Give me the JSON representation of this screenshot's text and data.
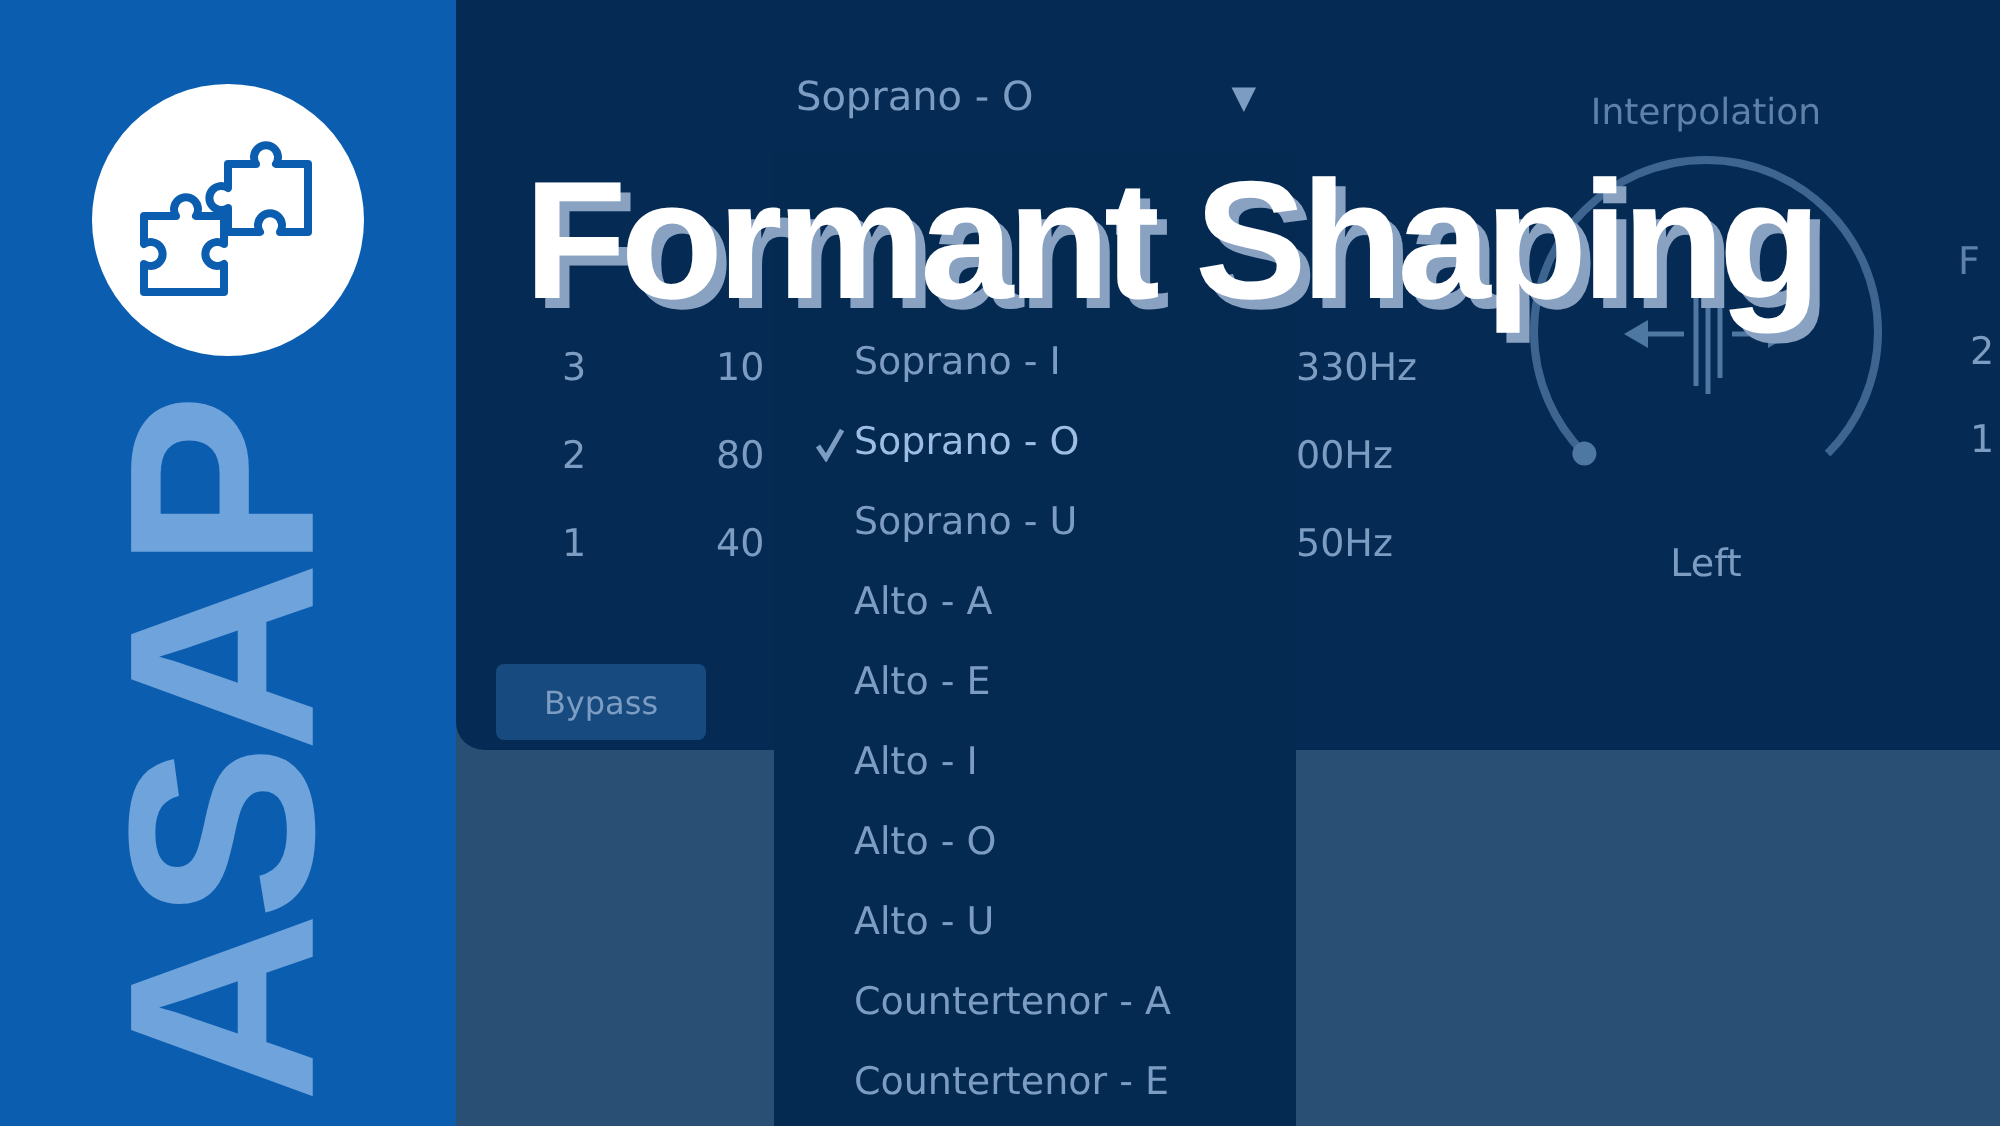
{
  "brand": {
    "text": "ASAP"
  },
  "plugin": {
    "vowel_dropdown": {
      "value": "Soprano - O",
      "caret": "▼"
    },
    "columns": [
      {
        "cells": [
          "3",
          "2",
          "1"
        ]
      },
      {
        "cells": [
          "10",
          "80",
          "40"
        ]
      },
      {
        "cells": [
          "330Hz",
          "00Hz",
          "50Hz"
        ]
      }
    ],
    "interpolation": {
      "label": "Interpolation",
      "reading": "Left"
    },
    "right_column": {
      "header": "F",
      "cells": [
        "2",
        "1"
      ]
    },
    "bypass_button": "Bypass"
  },
  "vowel_menu": [
    {
      "label": "Soprano - I",
      "selected": false
    },
    {
      "label": "Soprano - O",
      "selected": true
    },
    {
      "label": "Soprano - U",
      "selected": false
    },
    {
      "label": "Alto - A",
      "selected": false
    },
    {
      "label": "Alto - E",
      "selected": false
    },
    {
      "label": "Alto - I",
      "selected": false
    },
    {
      "label": "Alto - O",
      "selected": false
    },
    {
      "label": "Alto - U",
      "selected": false
    },
    {
      "label": "Countertenor - A",
      "selected": false
    },
    {
      "label": "Countertenor - E",
      "selected": false
    }
  ],
  "title": "Formant Shaping"
}
